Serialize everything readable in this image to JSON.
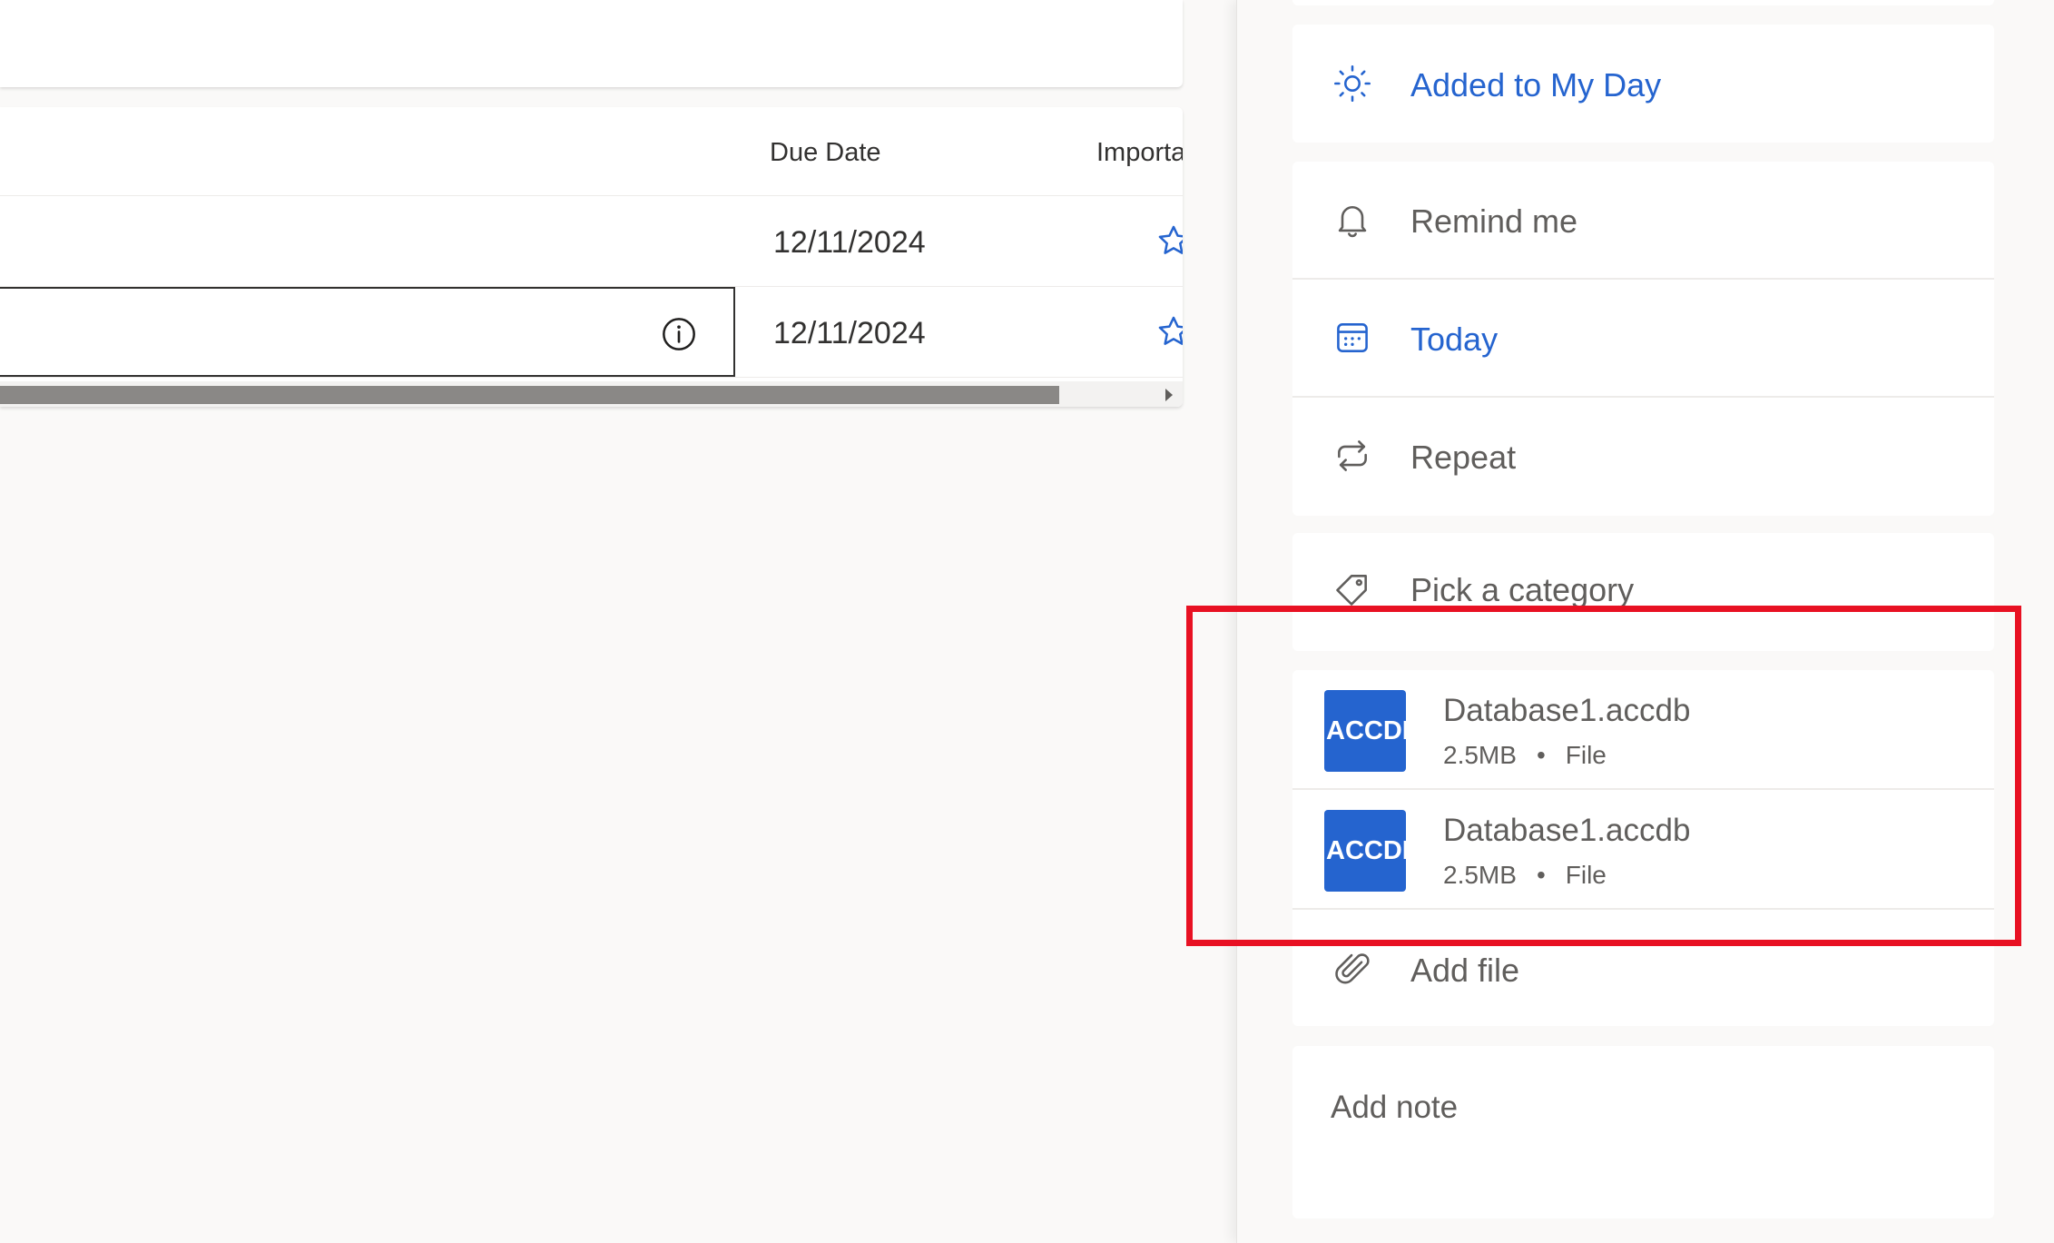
{
  "task_list": {
    "columns": {
      "due_date": "Due Date",
      "importance": "Importa"
    },
    "rows": [
      {
        "due_date": "12/11/2024"
      },
      {
        "due_date": "12/11/2024"
      }
    ]
  },
  "detail": {
    "my_day": {
      "label": "Added to My Day"
    },
    "remind": {
      "label": "Remind me"
    },
    "due": {
      "label": "Today"
    },
    "repeat": {
      "label": "Repeat"
    },
    "category": {
      "label": "Pick a category"
    },
    "files": [
      {
        "thumb": "ACCDB",
        "name": "Database1.accdb",
        "size": "2.5MB",
        "dot": "•",
        "type": "File"
      },
      {
        "thumb": "ACCDB",
        "name": "Database1.accdb",
        "size": "2.5MB",
        "dot": "•",
        "type": "File"
      }
    ],
    "add_file": {
      "label": "Add file"
    },
    "note": {
      "placeholder": "Add note"
    }
  },
  "colors": {
    "accent": "#2564cf",
    "highlight": "#e81123",
    "file_thumb": "#2564cf"
  },
  "icons": [
    "sun-icon",
    "bell-icon",
    "calendar-icon",
    "repeat-icon",
    "tag-icon",
    "paperclip-icon",
    "info-icon",
    "star-icon"
  ]
}
